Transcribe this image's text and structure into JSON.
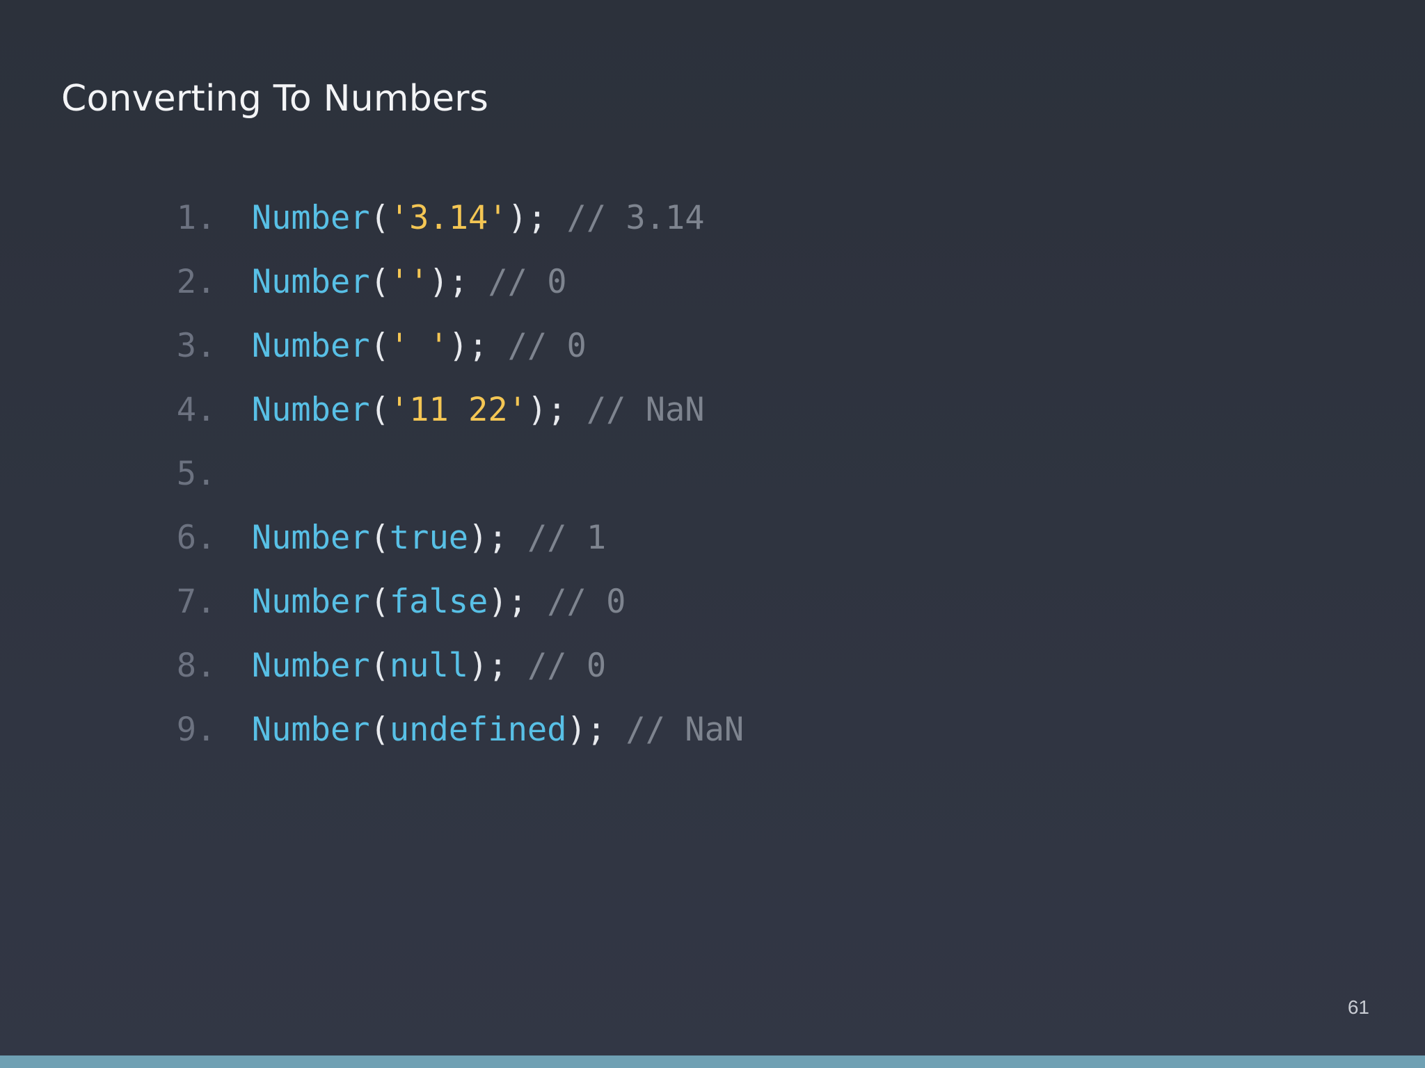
{
  "slide": {
    "title": "Converting To Numbers",
    "page_number": "61",
    "accent_color": "#6fa0b3"
  },
  "code": {
    "lines": [
      {
        "num": "1.",
        "fn": "Number",
        "open": "(",
        "arg": "'3.14'",
        "arg_type": "str",
        "close": ");",
        "comment": "// 3.14"
      },
      {
        "num": "2.",
        "fn": "Number",
        "open": "(",
        "arg": "''",
        "arg_type": "str",
        "close": ");",
        "comment": "// 0"
      },
      {
        "num": "3.",
        "fn": "Number",
        "open": "(",
        "arg": "' '",
        "arg_type": "str",
        "close": ");",
        "comment": "// 0"
      },
      {
        "num": "4.",
        "fn": "Number",
        "open": "(",
        "arg": "'11 22'",
        "arg_type": "str",
        "close": ");",
        "comment": "// NaN"
      },
      {
        "num": "5.",
        "fn": "",
        "open": "",
        "arg": "",
        "arg_type": "",
        "close": "",
        "comment": ""
      },
      {
        "num": "6.",
        "fn": "Number",
        "open": "(",
        "arg": "true",
        "arg_type": "kw",
        "close": ");",
        "comment": "// 1"
      },
      {
        "num": "7.",
        "fn": "Number",
        "open": "(",
        "arg": "false",
        "arg_type": "kw",
        "close": ");",
        "comment": "// 0"
      },
      {
        "num": "8.",
        "fn": "Number",
        "open": "(",
        "arg": "null",
        "arg_type": "kw",
        "close": ");",
        "comment": "// 0"
      },
      {
        "num": "9.",
        "fn": "Number",
        "open": "(",
        "arg": "undefined",
        "arg_type": "kw",
        "close": ");",
        "comment": "// NaN"
      }
    ]
  }
}
